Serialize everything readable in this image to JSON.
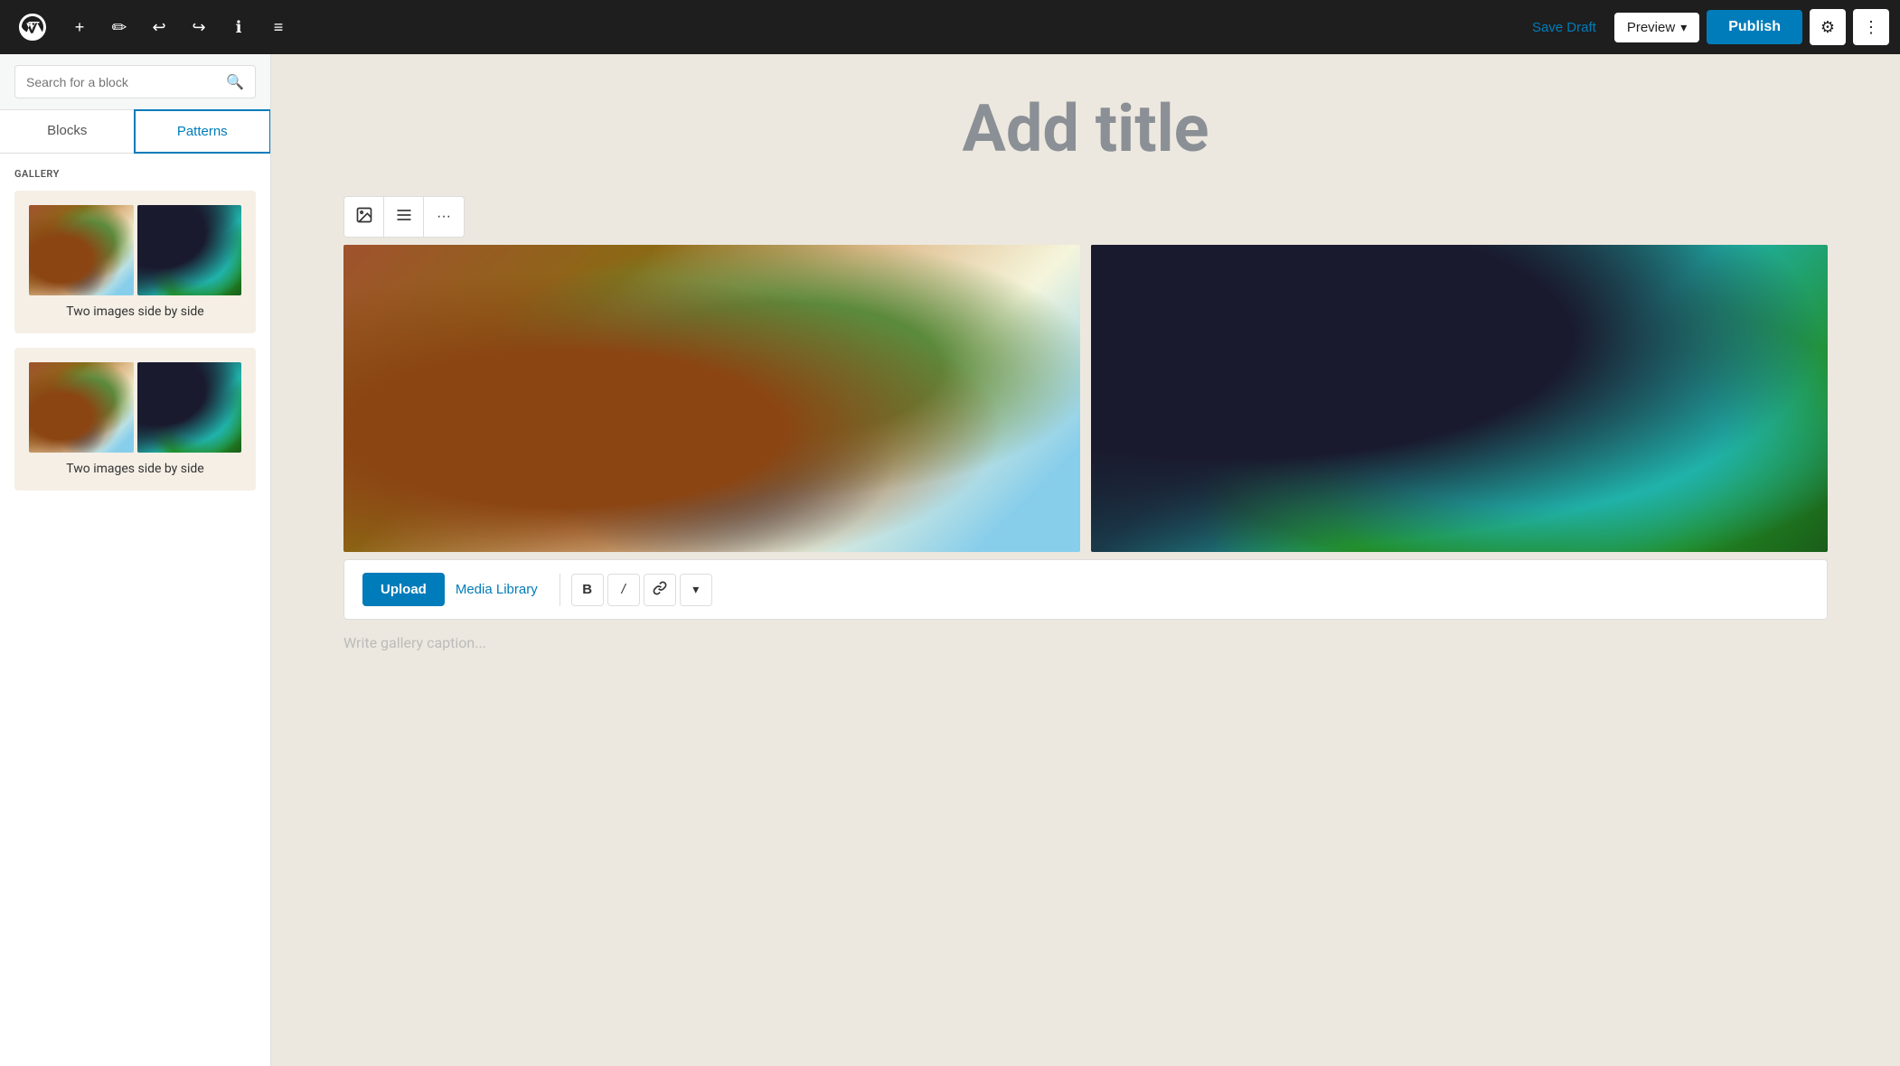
{
  "toolbar": {
    "wp_logo_alt": "WordPress",
    "add_label": "+",
    "tools_label": "✎",
    "undo_label": "↩",
    "redo_label": "↪",
    "info_label": "ℹ",
    "list_view_label": "≡",
    "save_draft_label": "Save Draft",
    "preview_label": "Preview",
    "publish_label": "Publish",
    "settings_label": "⚙",
    "more_label": "⋮"
  },
  "sidebar": {
    "search_placeholder": "Search for a block",
    "tab_blocks": "Blocks",
    "tab_patterns": "Patterns",
    "active_tab": "Patterns",
    "section_label": "GALLERY",
    "pattern_cards": [
      {
        "label": "Two images side by side"
      },
      {
        "label": "Two images side by side"
      }
    ]
  },
  "editor": {
    "title_placeholder": "Add title",
    "block_toolbar": {
      "gallery_icon": "🖼",
      "align_icon": "≡",
      "more_icon": "···"
    },
    "upload_btn": "Upload",
    "media_library_btn": "Media Library",
    "caption_placeholder": "Write gallery caption...",
    "format_bold": "B",
    "format_italic": "/",
    "format_link": "🔗",
    "format_more": "▾"
  }
}
